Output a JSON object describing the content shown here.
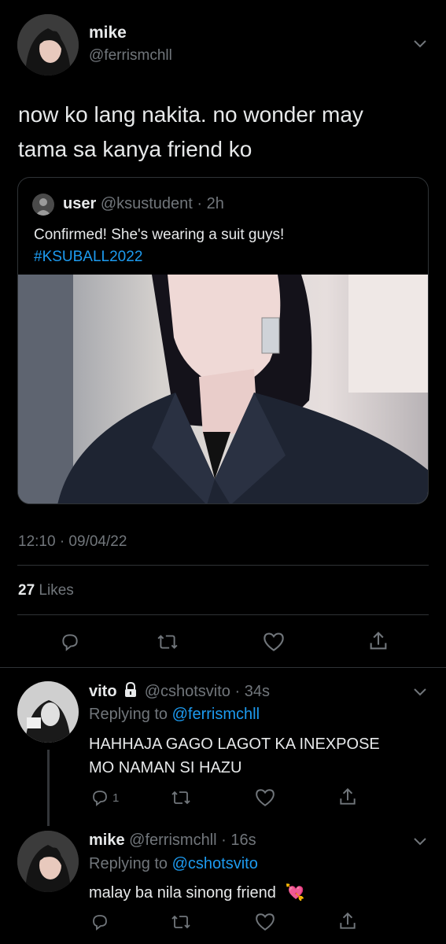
{
  "main_tweet": {
    "display_name": "mike",
    "handle": "@ferrismchll",
    "text_line1": "now ko lang nakita. no wonder may",
    "text_line2": "tama sa kanya friend ko",
    "timestamp": "12:10 · 09/04/22",
    "likes_count": "27",
    "likes_label": "Likes"
  },
  "quote_tweet": {
    "display_name": "user",
    "handle": "@ksustudent",
    "time": "· 2h",
    "text": "Confirmed! She's wearing a suit guys!",
    "hashtag": "#KSUBALL2022"
  },
  "reply1": {
    "display_name": "vito",
    "handle": "@cshotsvito",
    "time": "· 34s",
    "replying_to_label": "Replying to",
    "replying_to_handle": "@ferrismchll",
    "text_line1": "HAHHAJA GAGO LAGOT KA INEXPOSE",
    "text_line2": "MO NAMAN SI HAZU",
    "reply_count": "1"
  },
  "reply2": {
    "display_name": "mike",
    "handle": "@ferrismchll",
    "time": "· 16s",
    "replying_to_label": "Replying to",
    "replying_to_handle": "@cshotsvito",
    "text": "malay ba nila sinong friend",
    "emoji": "💘"
  },
  "colors": {
    "background": "#000000",
    "text": "#e7e9ea",
    "muted": "#71767b",
    "link": "#1d9bf0",
    "border": "#2f3336"
  }
}
